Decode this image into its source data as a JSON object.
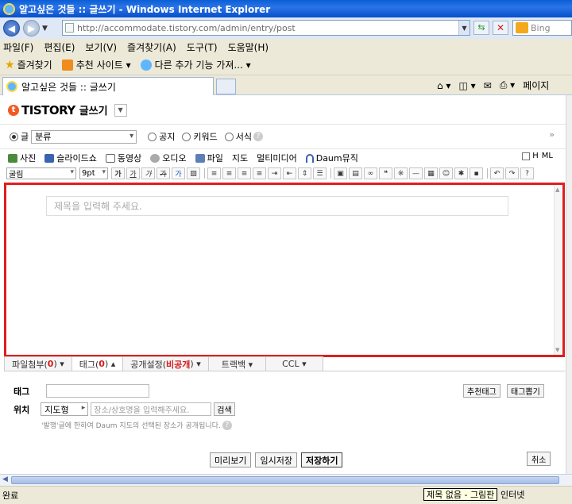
{
  "window": {
    "title": "알고싶은 것들 :: 글쓰기 - Windows Internet Explorer"
  },
  "address_bar": {
    "url": "http://accommodate.tistory.com/admin/entry/post",
    "search_placeholder": "Bing"
  },
  "menu": [
    "파일(F)",
    "편집(E)",
    "보기(V)",
    "즐겨찾기(A)",
    "도구(T)",
    "도움말(H)"
  ],
  "favorites_bar": {
    "favorites_label": "즐겨찾기",
    "items": [
      "추천 사이트 ▾",
      "다른 추가 기능 가져... ▾"
    ]
  },
  "tab": {
    "title": "알고싶은 것들 :: 글쓰기",
    "page_menu": "페이지"
  },
  "blog": {
    "logo": "TISTORY",
    "logo_sub": "글쓰기"
  },
  "post_types": {
    "selected": "글",
    "category": "분류",
    "options": [
      "공지",
      "키워드",
      "서식"
    ]
  },
  "attach_tools": [
    "사진",
    "슬라이드쇼",
    "동영상",
    "오디오",
    "파일",
    "지도",
    "멀티미디어",
    "Daum뮤직"
  ],
  "attach_right": [
    "H",
    "ML"
  ],
  "format_toolbar": {
    "font": "굴림",
    "size": "9pt",
    "buttons": [
      "가",
      "가",
      "가",
      "가",
      "가"
    ]
  },
  "editor": {
    "title_placeholder": "제목을 입력해 주세요."
  },
  "bottom_tabs": {
    "attach": {
      "label": "파일첨부(",
      "count": "0",
      "end": ") ▾"
    },
    "tag": {
      "label": "태그(",
      "count": "0",
      "end": ") ▴"
    },
    "public": {
      "label": "공개설정(",
      "value": "비공개",
      "end": ") ▾"
    },
    "trackback": "트랙백 ▾",
    "ccl": "CCL ▾"
  },
  "tag_section": {
    "label": "태그",
    "recommend": "추천태그",
    "tag_box": "태그뽑기"
  },
  "location_section": {
    "label": "위치",
    "type": "지도형",
    "placeholder": "장소/상호명을 입력해주세요.",
    "search": "검색",
    "note": "'발행'글에 한하여 Daum 지도의 선택된 장소가 공개됩니다."
  },
  "actions": {
    "preview": "미리보기",
    "temp_save": "임시저장",
    "save": "저장하기",
    "cancel": "취소"
  },
  "status": {
    "left": "완료",
    "tooltip": "제목 없음 - 그림판",
    "zone": "인터넷"
  }
}
